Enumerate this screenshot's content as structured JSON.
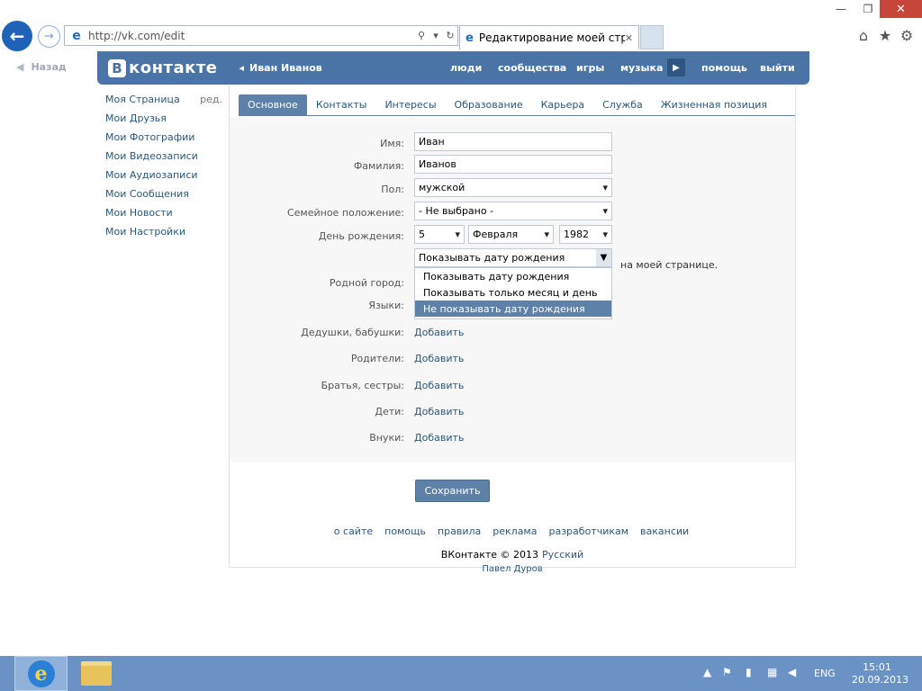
{
  "browser": {
    "url": "http://vk.com/edit",
    "tab_title": "Редактирование моей стр...",
    "min_glyph": "—",
    "max_glyph": "❐",
    "close_glyph": "✕"
  },
  "page": {
    "back_label": "Назад",
    "logo_text": "контакте",
    "logo_letter": "В",
    "user_name": "Иван Иванов",
    "nav": {
      "people": "люди",
      "groups": "сообщества",
      "games": "игры",
      "music": "музыка",
      "help": "помощь",
      "exit": "выйти"
    },
    "left_menu": [
      {
        "label": "Моя Страница",
        "extra": "ред."
      },
      {
        "label": "Мои Друзья"
      },
      {
        "label": "Мои Фотографии"
      },
      {
        "label": "Мои Видеозаписи"
      },
      {
        "label": "Мои Аудиозаписи"
      },
      {
        "label": "Мои Сообщения"
      },
      {
        "label": "Мои Новости"
      },
      {
        "label": "Мои Настройки"
      }
    ],
    "tabs": [
      "Основное",
      "Контакты",
      "Интересы",
      "Образование",
      "Карьера",
      "Служба",
      "Жизненная позиция"
    ],
    "form": {
      "labels": {
        "first_name": "Имя:",
        "last_name": "Фамилия:",
        "sex": "Пол:",
        "relationship": "Семейное положение:",
        "birthday": "День рождения:",
        "hometown": "Родной город:",
        "languages": "Языки:",
        "grandparents": "Дедушки, бабушки:",
        "parents": "Родители:",
        "siblings": "Братья, сестры:",
        "children": "Дети:",
        "grandchildren": "Внуки:"
      },
      "values": {
        "first_name": "Иван",
        "last_name": "Иванов",
        "sex": "мужской",
        "relationship": "- Не выбрано -",
        "bday_day": "5",
        "bday_month": "Февраля",
        "bday_year": "1982",
        "bday_visibility": "Показывать дату рождения"
      },
      "bday_note": "на моей странице.",
      "bday_options": [
        "Показывать дату рождения",
        "Показывать только месяц и день",
        "Не показывать дату рождения"
      ],
      "add_label": "Добавить",
      "save_label": "Сохранить"
    },
    "footer": {
      "links": [
        "о сайте",
        "помощь",
        "правила",
        "реклама",
        "разработчикам",
        "вакансии"
      ],
      "copyright": "ВКонтакте © 2013",
      "language": "Русский",
      "author": "Павел Дуров"
    }
  },
  "taskbar": {
    "lang": "ENG",
    "time": "15:01",
    "date": "20.09.2013"
  }
}
